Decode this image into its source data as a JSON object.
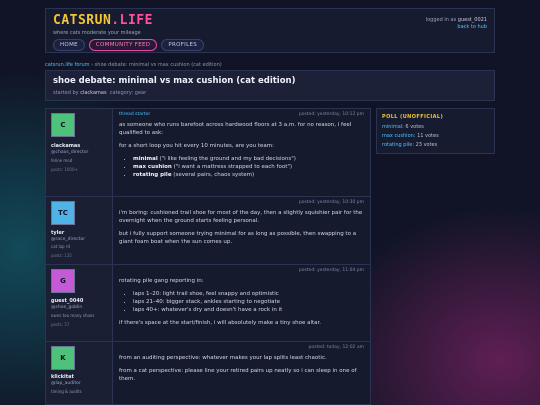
{
  "site": {
    "logo_main": "CATSRUN",
    "logo_tld": ".LIFE",
    "tagline": "where cats moderate your mileage"
  },
  "nav": [
    {
      "label": "HOME",
      "active": false
    },
    {
      "label": "COMMUNITY FEED",
      "active": true
    },
    {
      "label": "PROFILES",
      "active": false
    }
  ],
  "login": {
    "prefix": "logged in as",
    "user": "guest_0021",
    "back": "back to hub"
  },
  "breadcrumb": {
    "home": "catsrun.life forum",
    "sep": "›",
    "current": "shoe debate: minimal vs max cushion (cat edition)"
  },
  "thread": {
    "title": "shoe debate: minimal vs max cushion (cat edition)",
    "started_by_label": "started by",
    "author": "clackamas",
    "category_label": "category:",
    "category": "gear"
  },
  "posts": [
    {
      "avatar_text": "C",
      "avatar_color": "#4ec27a",
      "name": "clackamas",
      "handle": "@chaos_director",
      "role": "feline mod",
      "posts": "posts: 1000+",
      "tag": "thread starter",
      "time": "posted: yesterday, 10:12 pm",
      "p1": "as someone who runs barefoot across hardwood floors at 3 a.m. for no reason, i feel qualified to ask:",
      "p2": "for a short loop you hit every 10 minutes, are you team:",
      "items": [
        {
          "b": "minimal",
          "t": " (\"i like feeling the ground and my bad decisions\")"
        },
        {
          "b": "max cushion",
          "t": " (\"i want a mattress strapped to each foot\")"
        },
        {
          "b": "rotating pile",
          "t": " (several pairs, chaos system)"
        }
      ]
    },
    {
      "avatar_text": "TC",
      "avatar_color": "#4fb3e8",
      "name": "tyler",
      "handle": "@race_director",
      "role": "cat lap rd",
      "posts": "posts: 135",
      "time": "posted: yesterday, 10:30 pm",
      "p1": "i'm boring: cushioned trail shoe for most of the day, then a slightly squishier pair for the overnight when the ground starts feeling personal.",
      "p2": "but i fully support someone trying minimal for as long as possible, then swapping to a giant foam boat when the sun comes up."
    },
    {
      "avatar_text": "G",
      "avatar_color": "#c45ad6",
      "name": "guest_0040",
      "handle": "@shoe_goblin",
      "role": "owns too many shoes",
      "posts": "posts: 57",
      "time": "posted: yesterday, 11:04 pm",
      "p1": "rotating pile gang reporting in:",
      "items": [
        {
          "b": "",
          "t": "laps 1–20: light trail shoe, feel snappy and optimistic"
        },
        {
          "b": "",
          "t": "laps 21–40: bigger stack, ankles starting to negotiate"
        },
        {
          "b": "",
          "t": "laps 40+: whatever's dry and doesn't have a rock in it"
        }
      ],
      "p2": "if there's space at the start/finish, i will absolutely make a tiny shoe altar."
    },
    {
      "avatar_text": "K",
      "avatar_color": "#4ec27a",
      "name": "klickitat",
      "handle": "@lap_auditor",
      "role": "timing & audits",
      "posts": "",
      "time": "posted: today, 12:02 am",
      "p1": "from an auditing perspective: whatever makes your lap splits least chaotic.",
      "p2": "from a cat perspective: please line your retired pairs up neatly so i can sleep in one of them."
    }
  ],
  "poll": {
    "title": "POLL (UNOFFICIAL)",
    "options": [
      {
        "label": "minimal:",
        "votes": "6 votes"
      },
      {
        "label": "max cushion:",
        "votes": "11 votes"
      },
      {
        "label": "rotating pile:",
        "votes": "23 votes"
      }
    ]
  },
  "colors": {
    "accent_yellow": "#f3c537",
    "accent_pink": "#ff4fa3",
    "link_blue": "#4fc3ff",
    "bg": "#101426"
  }
}
